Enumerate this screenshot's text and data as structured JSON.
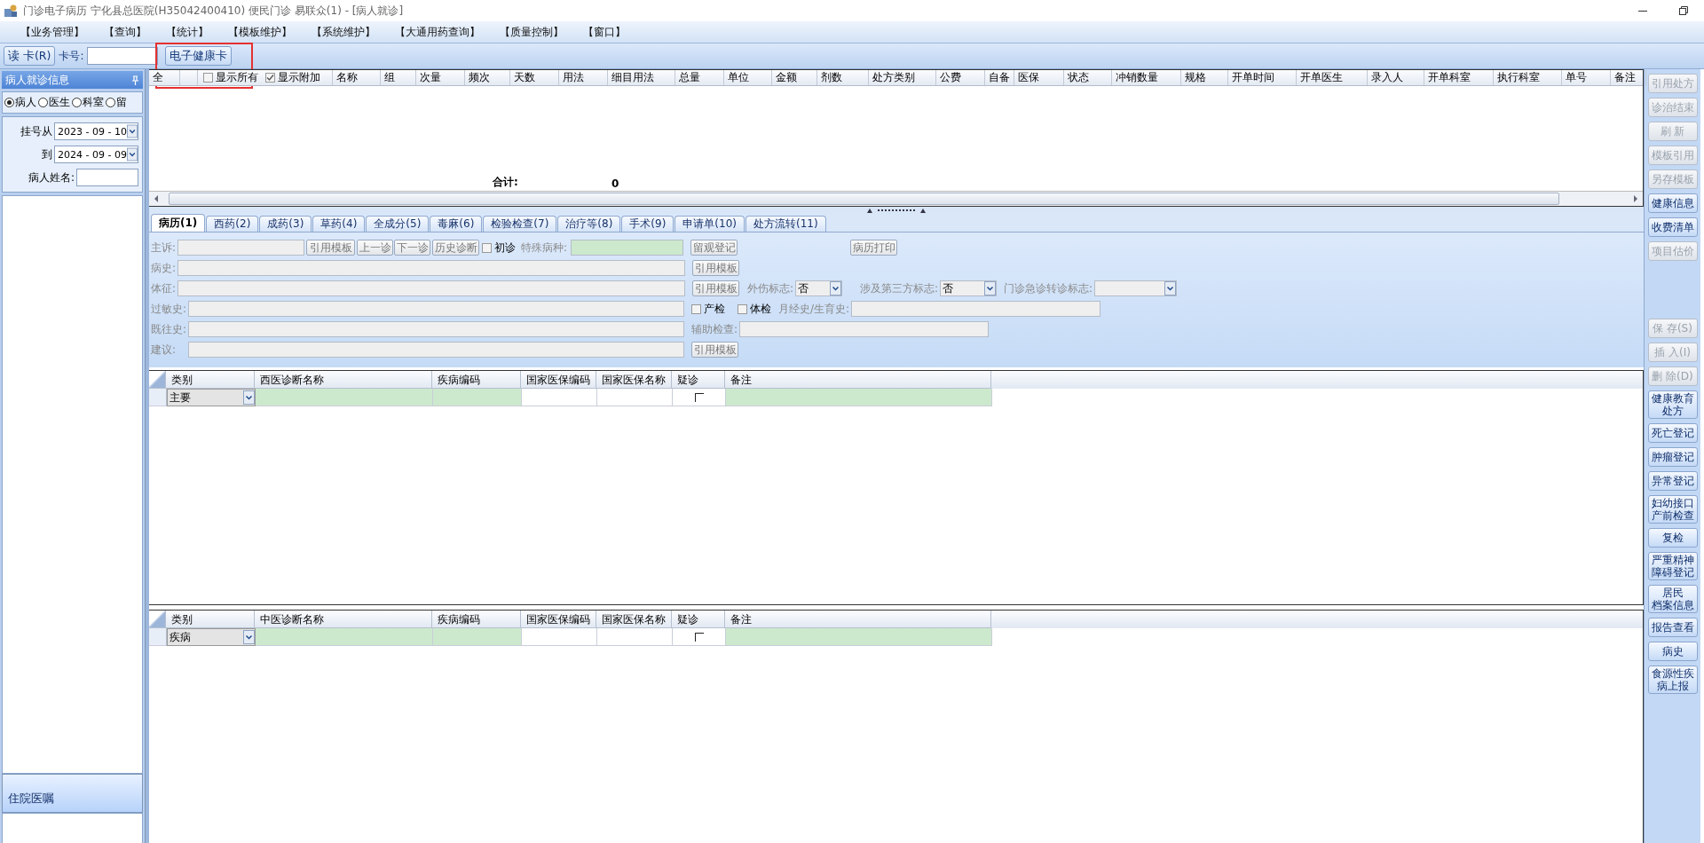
{
  "window": {
    "title": "门诊电子病历  宁化县总医院(H35042400410)  便民门诊  易联众(1) - [病人就诊]"
  },
  "menu": [
    "【业务管理】",
    "【查询】",
    "【统计】",
    "【模板维护】",
    "【系统维护】",
    "【大通用药查询】",
    "【质量控制】",
    "【窗口】"
  ],
  "toolbar": {
    "read_card": "读 卡(R)",
    "card_label": "卡号:",
    "health_card": "电子健康卡"
  },
  "left_panel": {
    "title": "病人就诊信息",
    "radios": [
      {
        "label": "病人",
        "selected": true
      },
      {
        "label": "医生",
        "selected": false
      },
      {
        "label": "科室",
        "selected": false
      },
      {
        "label": "留",
        "selected": false
      }
    ],
    "date_from_label": "挂号从",
    "date_from": "2023 - 09 - 10",
    "date_to_label": "到",
    "date_to": "2024 - 09 - 09",
    "name_label": "病人姓名:",
    "bottom_title": "住院医嘱"
  },
  "orders_table": {
    "select_all": "全",
    "show_all": {
      "label": "显示所有",
      "checked": false
    },
    "show_extra": {
      "label": "显示附加",
      "checked": true
    },
    "columns": [
      "名称",
      "组",
      "次量",
      "频次",
      "天数",
      "用法",
      "细目用法",
      "总量",
      "单位",
      "金额",
      "剂数",
      "处方类别",
      "公费",
      "自备",
      "医保",
      "状态",
      "冲销数量",
      "规格",
      "开单时间",
      "开单医生",
      "录入人",
      "开单科室",
      "执行科室",
      "单号",
      "备注"
    ],
    "total_label": "合计:",
    "total": "0"
  },
  "tabs": [
    {
      "label": "病历(1)",
      "selected": true
    },
    {
      "label": "西药(2)",
      "selected": false
    },
    {
      "label": "成药(3)",
      "selected": false
    },
    {
      "label": "草药(4)",
      "selected": false
    },
    {
      "label": "全成分(5)",
      "selected": false
    },
    {
      "label": "毒麻(6)",
      "selected": false
    },
    {
      "label": "检验检查(7)",
      "selected": false
    },
    {
      "label": "治疗等(8)",
      "selected": false
    },
    {
      "label": "手术(9)",
      "selected": false
    },
    {
      "label": "申请单(10)",
      "selected": false
    },
    {
      "label": "处方流转(11)",
      "selected": false
    }
  ],
  "record_form": [
    [
      {
        "kind": "label",
        "text": "主诉:"
      },
      {
        "kind": "field",
        "highlighted": false
      },
      {
        "kind": "button",
        "text": "引用模板"
      },
      {
        "kind": "button",
        "text": "上一诊"
      },
      {
        "kind": "button",
        "text": "下一诊"
      },
      {
        "kind": "button",
        "text": "历史诊断"
      },
      {
        "kind": "checkbox",
        "text": "初诊",
        "checked": false
      },
      {
        "kind": "label",
        "text": "特殊病种:"
      },
      {
        "kind": "field",
        "highlighted": true
      },
      {
        "kind": "button",
        "text": "留观登记"
      },
      {
        "kind": "button",
        "text": "病历打印"
      }
    ],
    [
      {
        "kind": "label",
        "text": "病史:"
      },
      {
        "kind": "field",
        "highlighted": false
      },
      {
        "kind": "button",
        "text": "引用模板"
      }
    ],
    [
      {
        "kind": "label",
        "text": "体征:"
      },
      {
        "kind": "field",
        "highlighted": false
      },
      {
        "kind": "button",
        "text": "引用模板"
      },
      {
        "kind": "label",
        "text": "外伤标志:"
      },
      {
        "kind": "select",
        "value": "否"
      },
      {
        "kind": "label",
        "text": "涉及第三方标志:"
      },
      {
        "kind": "select",
        "value": "否"
      },
      {
        "kind": "label",
        "text": "门诊急诊转诊标志:"
      },
      {
        "kind": "select"
      }
    ],
    [
      {
        "kind": "label",
        "text": "过敏史:"
      },
      {
        "kind": "field",
        "highlighted": false
      },
      {
        "kind": "checkbox",
        "text": "产检",
        "checked": false
      },
      {
        "kind": "checkbox",
        "text": "体检",
        "checked": false
      },
      {
        "kind": "label",
        "text": "月经史/生育史:"
      },
      {
        "kind": "field",
        "highlighted": false
      }
    ],
    [
      {
        "kind": "label",
        "text": "既往史:"
      },
      {
        "kind": "field",
        "highlighted": false
      },
      {
        "kind": "label",
        "text": "辅助检查:"
      },
      {
        "kind": "field",
        "highlighted": false
      }
    ],
    [
      {
        "kind": "label",
        "text": "建议:"
      },
      {
        "kind": "field",
        "highlighted": false
      },
      {
        "kind": "button",
        "text": "引用模板"
      }
    ]
  ],
  "western_diagnosis": {
    "columns": [
      "类别",
      "西医诊断名称",
      "疾病编码",
      "国家医保编码",
      "国家医保名称",
      "疑诊",
      "备注"
    ],
    "rows": [
      {
        "category": "主要",
        "suspected": false,
        "cells": [
          {
            "highlighted": true
          },
          {
            "highlighted": true
          },
          {
            "highlighted": false
          },
          {
            "highlighted": false
          },
          {
            "highlighted": true
          }
        ]
      }
    ]
  },
  "tcm_diagnosis": {
    "columns": [
      "类别",
      "中医诊断名称",
      "疾病编码",
      "国家医保编码",
      "国家医保名称",
      "疑诊",
      "备注"
    ],
    "rows": [
      {
        "category": "疾病",
        "suspected": false,
        "cells": [
          {
            "highlighted": true
          },
          {
            "highlighted": true
          },
          {
            "highlighted": false
          },
          {
            "highlighted": false
          },
          {
            "highlighted": true
          }
        ]
      }
    ]
  },
  "right_toolbar": {
    "top": [
      {
        "lines": [
          "引用处方"
        ],
        "disabled": true
      },
      {
        "lines": [
          "诊治结束"
        ],
        "disabled": true
      },
      {
        "lines": [
          "刷 新"
        ],
        "disabled": true
      },
      {
        "lines": [
          "模板引用"
        ],
        "disabled": true
      },
      {
        "lines": [
          "另存模板"
        ],
        "disabled": true
      },
      {
        "lines": [
          "健康信息"
        ],
        "disabled": false
      },
      {
        "lines": [
          "收费清单"
        ],
        "disabled": false
      },
      {
        "lines": [
          "项目估价"
        ],
        "disabled": true
      }
    ],
    "bottom": [
      {
        "lines": [
          "保 存(S)"
        ],
        "disabled": true
      },
      {
        "lines": [
          "插 入(I)"
        ],
        "disabled": true
      },
      {
        "lines": [
          "删 除(D)"
        ],
        "disabled": true
      },
      {
        "lines": [
          "健康教育",
          "处方"
        ],
        "disabled": false
      },
      {
        "lines": [
          "死亡登记"
        ],
        "disabled": false
      },
      {
        "lines": [
          "肿瘤登记"
        ],
        "disabled": false
      },
      {
        "lines": [
          "异常登记"
        ],
        "disabled": false
      },
      {
        "lines": [
          "妇幼接口",
          "产前检查"
        ],
        "disabled": false
      },
      {
        "lines": [
          "复检"
        ],
        "disabled": false
      },
      {
        "lines": [
          "严重精神",
          "障碍登记"
        ],
        "disabled": false
      },
      {
        "lines": [
          "居民",
          "档案信息"
        ],
        "disabled": false
      },
      {
        "lines": [
          "报告查看"
        ],
        "disabled": false
      },
      {
        "lines": [
          "病史"
        ],
        "disabled": false
      },
      {
        "lines": [
          "食源性疾",
          "病上报"
        ],
        "disabled": false
      }
    ]
  }
}
